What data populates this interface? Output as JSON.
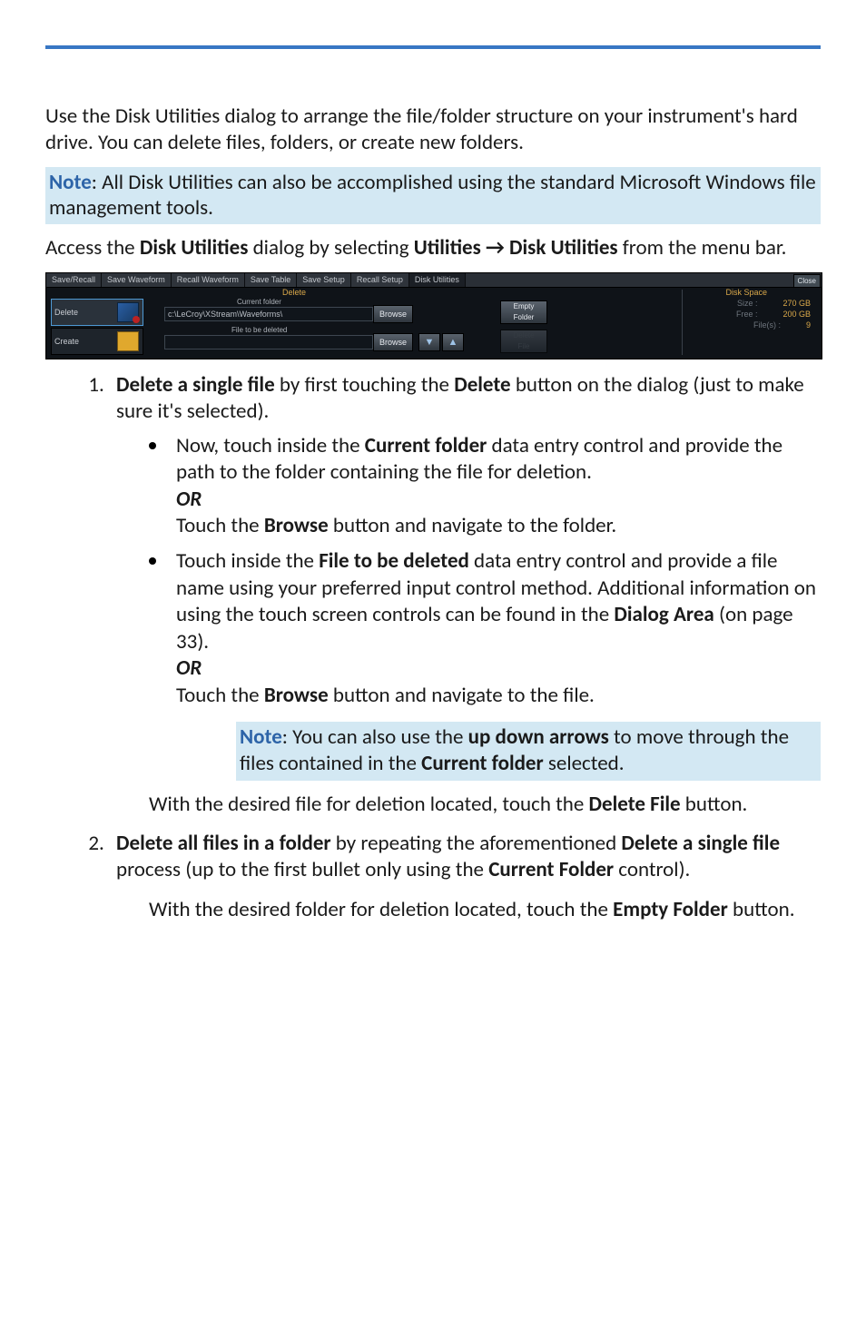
{
  "intro_p1": "Use the Disk Utilities dialog to arrange the file/folder structure on your instrument's hard drive. You can delete files, folders, or create new folders.",
  "note1_lead": "Note",
  "note1_body": ": All Disk Utilities can also be accomplished using the standard Microsoft Windows file management tools.",
  "access_pre": "Access the ",
  "access_b1": "Disk Utilities",
  "access_mid": " dialog by selecting ",
  "access_b2": "Utilities → Disk Utilities",
  "access_post": " from the menu bar.",
  "dlg": {
    "tabs": {
      "t0": "Save/Recall",
      "t1": "Save Waveform",
      "t2": "Recall Waveform",
      "t3": "Save Table",
      "t4": "Save Setup",
      "t5": "Recall Setup",
      "t6": "Disk Utilities"
    },
    "close": "Close",
    "section": "Delete",
    "side": {
      "delete": "Delete",
      "create": "Create"
    },
    "labels": {
      "current_folder": "Current folder",
      "file_to_be_deleted": "File to be deleted"
    },
    "values": {
      "current_folder": "c:\\LeCroy\\XStream\\Waveforms\\"
    },
    "browse": "Browse",
    "empty_folder": "Empty\nFolder",
    "delete_file": "Delete\nFile",
    "disk_space": {
      "title": "Disk Space",
      "size_k": "Size :",
      "size_v": "270 GB",
      "free_k": "Free :",
      "free_v": "200 GB",
      "files_k": "File(s) :",
      "files_v": "9"
    }
  },
  "li1_a": "Delete a single file",
  "li1_b": " by first touching the ",
  "li1_c": "Delete",
  "li1_d": " button on the dialog (just to make sure it's selected).",
  "b1_a": "Now, touch inside the ",
  "b1_b": "Current folder",
  "b1_c": " data entry control and provide the path to the folder containing the file for deletion.",
  "or": "OR",
  "b1_d": "Touch the ",
  "b1_e": "Browse",
  "b1_f": " button and navigate to the folder.",
  "b2_a": "Touch inside the ",
  "b2_b": "File to be deleted",
  "b2_c": " data entry control and provide a file name using your preferred input control method. Additional information on using the touch screen controls can be found in the ",
  "b2_d": "Dialog Area",
  "b2_e": " (on page 33).",
  "b2_f": "Touch the ",
  "b2_g": "Browse",
  "b2_h": " button and navigate to the file.",
  "note2_lead": "Note",
  "note2_a": ": You can also use the ",
  "note2_b": "up down arrows",
  "note2_c": " to move through the files contained in the ",
  "note2_d": "Current folder",
  "note2_e": " selected.",
  "after1_a": "With the desired file for deletion located, touch the ",
  "after1_b": "Delete File",
  "after1_c": " button.",
  "li2_a": "Delete all files in a folder",
  "li2_b": " by repeating the aforementioned ",
  "li2_c": "Delete a single file",
  "li2_d": " process (up to the first bullet only using the ",
  "li2_e": "Current Folder",
  "li2_f": " control).",
  "after2_a": "With the desired folder for deletion located, touch the ",
  "after2_b": "Empty Folder",
  "after2_c": " button."
}
